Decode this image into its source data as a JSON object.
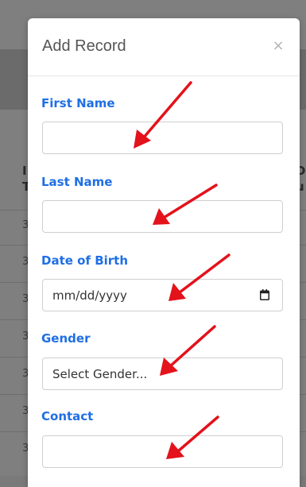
{
  "modal": {
    "title": "Add Record",
    "close_label": "×"
  },
  "fields": {
    "first_name": {
      "label": "First Name",
      "value": ""
    },
    "last_name": {
      "label": "Last Name",
      "value": ""
    },
    "dob": {
      "label": "Date of Birth",
      "placeholder": "mm/dd/yyyy"
    },
    "gender": {
      "label": "Gender",
      "selected": "Select Gender..."
    },
    "contact": {
      "label": "Contact",
      "value": ""
    }
  },
  "background": {
    "header_glyphs": [
      "I",
      "T",
      "D",
      "u"
    ],
    "row_glyph": "3"
  },
  "icons": {
    "calendar": "calendar-icon",
    "annotation_arrows": "red-arrow"
  },
  "colors": {
    "label": "#1f6fe5",
    "overlay": "#7f7f7f",
    "arrow": "#e3121b"
  }
}
